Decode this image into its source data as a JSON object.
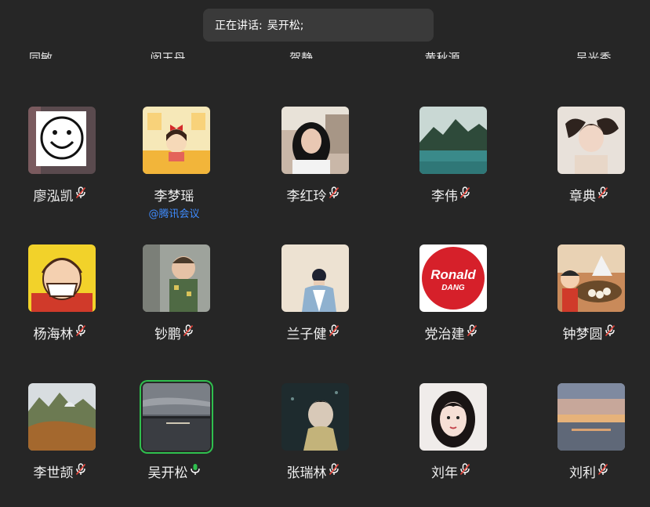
{
  "speaking_banner": {
    "label": "正在讲话:",
    "names": "吴开松;"
  },
  "top_row": [
    {
      "name": "同敏"
    },
    {
      "name": "闵玉丹"
    },
    {
      "name": "贺静"
    },
    {
      "name": "黄秋源"
    },
    {
      "name": "吴光秀"
    }
  ],
  "participants": [
    {
      "name": "廖泓凯",
      "mic": "muted",
      "avatar_icon": "smiley-face-avatar"
    },
    {
      "name": "李梦瑶",
      "mic": "none",
      "avatar_icon": "cartoon-girl-avatar",
      "sub_label": "@腾讯会议"
    },
    {
      "name": "李红玲",
      "mic": "muted",
      "avatar_icon": "woman-portrait-avatar"
    },
    {
      "name": "李伟",
      "mic": "muted",
      "avatar_icon": "mountain-lake-avatar"
    },
    {
      "name": "章典",
      "mic": "muted",
      "avatar_icon": "woman-lying-avatar"
    },
    {
      "name": "杨海林",
      "mic": "muted",
      "avatar_icon": "cartoon-mask-man-avatar"
    },
    {
      "name": "钞鹏",
      "mic": "muted",
      "avatar_icon": "baby-photo-avatar"
    },
    {
      "name": "兰子健",
      "mic": "muted",
      "avatar_icon": "illustrated-boy-avatar"
    },
    {
      "name": "党治建",
      "mic": "muted",
      "avatar_icon": "ronald-dang-logo-avatar",
      "logo_text": [
        "Ronald",
        "DANG"
      ]
    },
    {
      "name": "钟梦圆",
      "mic": "muted",
      "avatar_icon": "cartoon-kid-dumplings-avatar"
    },
    {
      "name": "李世颉",
      "mic": "muted",
      "avatar_icon": "hillside-landscape-avatar"
    },
    {
      "name": "吴开松",
      "mic": "speaking",
      "avatar_icon": "sunset-lake-avatar",
      "active_speaker": true
    },
    {
      "name": "张瑞林",
      "mic": "muted",
      "avatar_icon": "anime-boy-avatar"
    },
    {
      "name": "刘年",
      "mic": "muted",
      "avatar_icon": "girl-selfie-avatar"
    },
    {
      "name": "刘利",
      "mic": "muted",
      "avatar_icon": "sunset-sea-avatar"
    }
  ],
  "colors": {
    "background": "#262626",
    "banner": "#3a3a3a",
    "active_border": "#2fbf4e",
    "speaking_mic": "#2fbf4e",
    "sub_label": "#3f8cff",
    "muted_slash": "#e8443a"
  }
}
